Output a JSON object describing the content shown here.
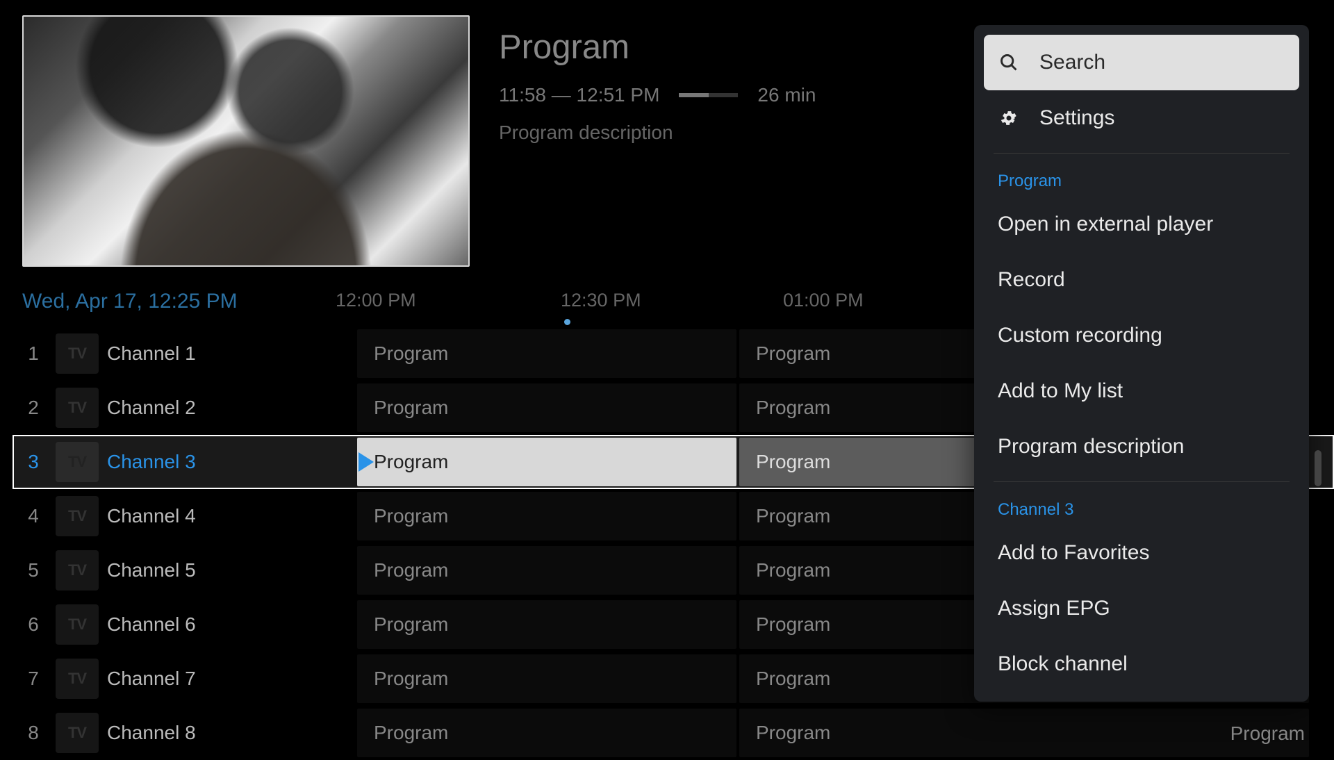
{
  "preview": {
    "alt": "stream-preview"
  },
  "info": {
    "title": "Program",
    "time": "11:58 — 12:51 PM",
    "duration": "26 min",
    "description": "Program description"
  },
  "timeline": {
    "date": "Wed, Apr 17, 12:25 PM",
    "ticks": [
      "12:00 PM",
      "12:30 PM",
      "01:00 PM"
    ]
  },
  "channels": [
    {
      "num": "1",
      "name": "Channel 1",
      "p1": "Program",
      "p2": "Program",
      "selected": false
    },
    {
      "num": "2",
      "name": "Channel 2",
      "p1": "Program",
      "p2": "Program",
      "selected": false
    },
    {
      "num": "3",
      "name": "Channel 3",
      "p1": "Program",
      "p2": "Program",
      "selected": true
    },
    {
      "num": "4",
      "name": "Channel 4",
      "p1": "Program",
      "p2": "Program",
      "selected": false
    },
    {
      "num": "5",
      "name": "Channel 5",
      "p1": "Program",
      "p2": "Program",
      "selected": false
    },
    {
      "num": "6",
      "name": "Channel 6",
      "p1": "Program",
      "p2": "Program",
      "selected": false
    },
    {
      "num": "7",
      "name": "Channel 7",
      "p1": "Program",
      "p2": "Program",
      "selected": false
    },
    {
      "num": "8",
      "name": "Channel 8",
      "p1": "Program",
      "p2": "Program",
      "selected": false
    }
  ],
  "channel_logo_text": "TV",
  "menu": {
    "search": "Search",
    "settings": "Settings",
    "program_header": "Program",
    "open_external": "Open in external player",
    "record": "Record",
    "custom_recording": "Custom recording",
    "add_list": "Add to My list",
    "program_description": "Program description",
    "channel_header": "Channel 3",
    "add_favorites": "Add to Favorites",
    "assign_epg": "Assign EPG",
    "block_channel": "Block channel"
  },
  "trailing_program": "Program"
}
